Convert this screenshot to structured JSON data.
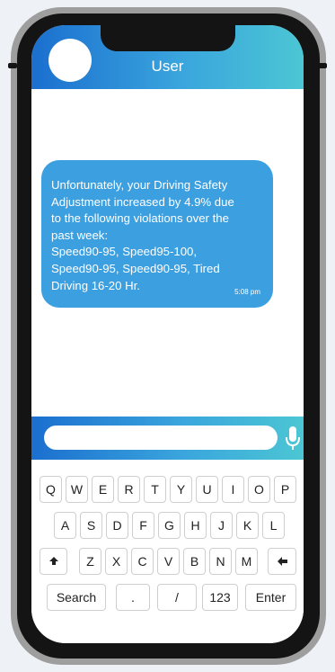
{
  "header": {
    "title": "User"
  },
  "message": {
    "text": "Unfortunately, your Driving Safety\nAdjustment increased by 4.9% due\nto the following violations over the\npast week:\nSpeed90-95, Speed95-100,\nSpeed90-95, Speed90-95, Tired\nDriving 16-20 Hr.",
    "time": "5:08 pm"
  },
  "compose": {
    "value": "",
    "mic_icon": "microphone-icon"
  },
  "keyboard": {
    "row1": [
      "Q",
      "W",
      "E",
      "R",
      "T",
      "Y",
      "U",
      "I",
      "O",
      "P"
    ],
    "row2": [
      "A",
      "S",
      "D",
      "F",
      "G",
      "H",
      "J",
      "K",
      "L"
    ],
    "row3": [
      "Z",
      "X",
      "C",
      "V",
      "B",
      "N",
      "M"
    ],
    "shift_icon": "shift-arrow-icon",
    "backspace_icon": "backspace-arrow-icon",
    "bottom": {
      "search": "Search",
      "period": ".",
      "slash": "/",
      "numbers": "123",
      "enter": "Enter"
    }
  },
  "colors": {
    "accent_blue": "#1b6fcf",
    "accent_teal": "#4cc6d4",
    "bubble": "#3c9fe0"
  }
}
